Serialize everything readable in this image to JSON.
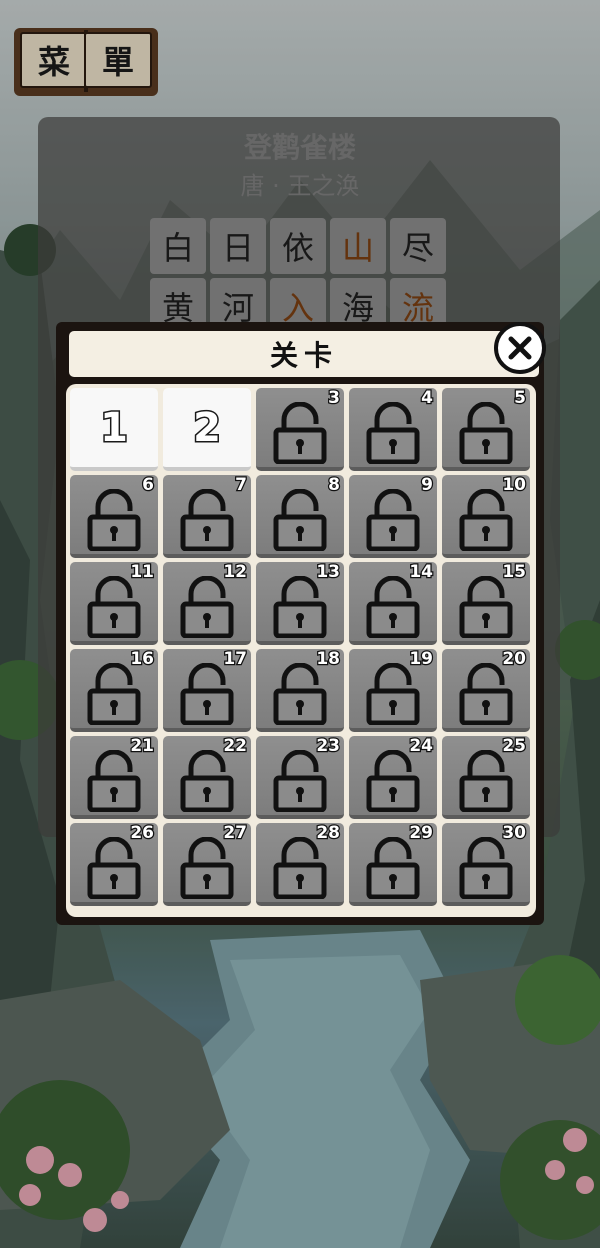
{
  "menu": {
    "left_char": "菜",
    "right_char": "單"
  },
  "poem": {
    "title": "登鹳雀楼",
    "author": "唐 · 王之涣",
    "row1": [
      "白",
      "日",
      "依",
      "山",
      "尽"
    ],
    "row2": [
      "黄",
      "河",
      "入",
      "海",
      "流"
    ],
    "highlight_color": "#7a3f12"
  },
  "level_modal": {
    "title": "关卡",
    "close_icon": "close-x-icon",
    "levels": [
      {
        "number": "1",
        "state": "unlocked"
      },
      {
        "number": "2",
        "state": "unlocked"
      },
      {
        "number": "3",
        "state": "locked"
      },
      {
        "number": "4",
        "state": "locked"
      },
      {
        "number": "5",
        "state": "locked"
      },
      {
        "number": "6",
        "state": "locked"
      },
      {
        "number": "7",
        "state": "locked"
      },
      {
        "number": "8",
        "state": "locked"
      },
      {
        "number": "9",
        "state": "locked"
      },
      {
        "number": "10",
        "state": "locked"
      },
      {
        "number": "11",
        "state": "locked"
      },
      {
        "number": "12",
        "state": "locked"
      },
      {
        "number": "13",
        "state": "locked"
      },
      {
        "number": "14",
        "state": "locked"
      },
      {
        "number": "15",
        "state": "locked"
      },
      {
        "number": "16",
        "state": "locked"
      },
      {
        "number": "17",
        "state": "locked"
      },
      {
        "number": "18",
        "state": "locked"
      },
      {
        "number": "19",
        "state": "locked"
      },
      {
        "number": "20",
        "state": "locked"
      },
      {
        "number": "21",
        "state": "locked"
      },
      {
        "number": "22",
        "state": "locked"
      },
      {
        "number": "23",
        "state": "locked"
      },
      {
        "number": "24",
        "state": "locked"
      },
      {
        "number": "25",
        "state": "locked"
      },
      {
        "number": "26",
        "state": "locked"
      },
      {
        "number": "27",
        "state": "locked"
      },
      {
        "number": "28",
        "state": "locked"
      },
      {
        "number": "29",
        "state": "locked"
      },
      {
        "number": "30",
        "state": "locked"
      }
    ]
  },
  "colors": {
    "modal_frame": "#1b1410",
    "board_bg": "#f1ebde",
    "locked_tile": "#8a8a8a",
    "unlocked_tile": "#f8f8f8"
  }
}
